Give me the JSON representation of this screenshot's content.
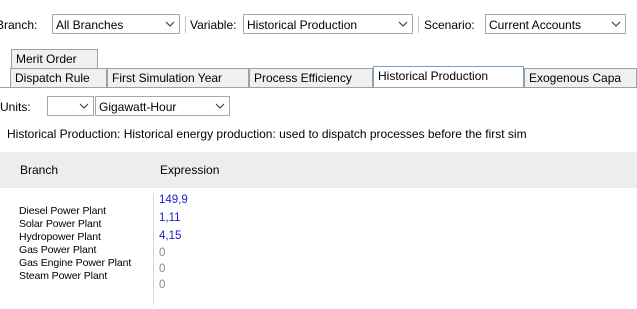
{
  "toolbar": {
    "branch_label": "Branch:",
    "branch_value": "All Branches",
    "variable_label": "Variable:",
    "variable_value": "Historical Production",
    "scenario_label": "Scenario:",
    "scenario_value": "Current Accounts",
    "merit_order_label": "Merit Order"
  },
  "tabs": [
    {
      "label": "Dispatch Rule",
      "active": false
    },
    {
      "label": "First Simulation Year",
      "active": false
    },
    {
      "label": "Process Efficiency",
      "active": false
    },
    {
      "label": "Historical Production",
      "active": true
    },
    {
      "label": "Exogenous Capa",
      "active": false
    }
  ],
  "units": {
    "label": "Units:",
    "prefix_value": "",
    "unit_value": "Gigawatt-Hour"
  },
  "description": "Historical Production: Historical energy production: used to dispatch processes before the first sim",
  "grid": {
    "columns": [
      "Branch",
      "Expression"
    ],
    "rows": [
      {
        "branch": "Diesel Power Plant",
        "expression": "149,9"
      },
      {
        "branch": "Solar Power Plant",
        "expression": "1,11"
      },
      {
        "branch": "Hydropower Plant",
        "expression": "4,15"
      },
      {
        "branch": "Gas Power Plant",
        "expression": "0"
      },
      {
        "branch": "Gas Engine Power Plant",
        "expression": "0"
      },
      {
        "branch": "Steam Power Plant",
        "expression": "0"
      }
    ]
  },
  "colors": {
    "entered_value": "#1a1acc",
    "default_value": "#8a8a8a",
    "active_tab_border": "#7a9cc6"
  }
}
